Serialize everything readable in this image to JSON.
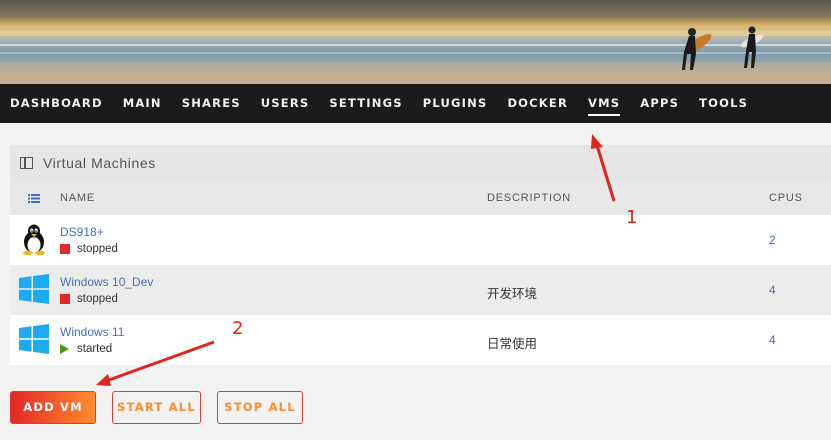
{
  "nav": {
    "items": [
      "DASHBOARD",
      "MAIN",
      "SHARES",
      "USERS",
      "SETTINGS",
      "PLUGINS",
      "DOCKER",
      "VMS",
      "APPS",
      "TOOLS"
    ],
    "active": "VMS"
  },
  "panel": {
    "title": "Virtual Machines",
    "columns": {
      "name": "NAME",
      "description": "DESCRIPTION",
      "cpus": "CPUS"
    }
  },
  "vms": [
    {
      "name": "DS918+",
      "state": "stopped",
      "description": "",
      "cpus": "2",
      "os_icon": "linux-tux-icon"
    },
    {
      "name": "Windows 10_Dev",
      "state": "stopped",
      "description": "开发环境",
      "cpus": "4",
      "os_icon": "windows-icon"
    },
    {
      "name": "Windows 11",
      "state": "started",
      "description": "日常使用",
      "cpus": "4",
      "os_icon": "windows-icon"
    }
  ],
  "buttons": {
    "add_vm": "ADD VM",
    "start_all": "START ALL",
    "stop_all": "STOP ALL"
  },
  "annotations": {
    "one": "1",
    "two": "2"
  },
  "colors": {
    "nav_bg": "#1c1b1b",
    "link": "#486dba",
    "stopped": "#e22828",
    "started": "#4e9a06",
    "accent": "#ff8c2f",
    "annotation": "#e2241a"
  }
}
